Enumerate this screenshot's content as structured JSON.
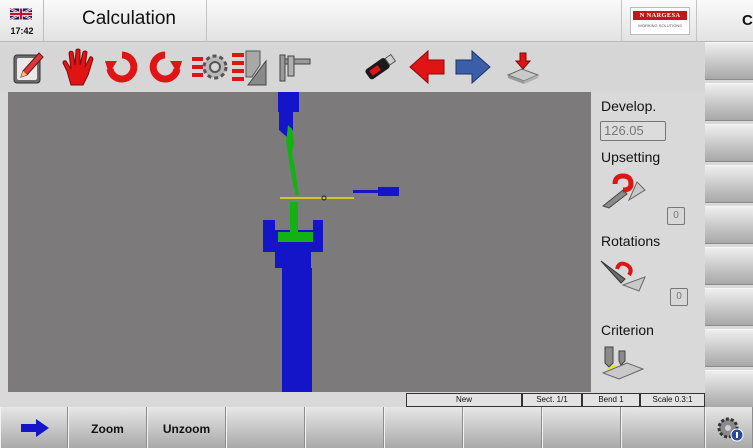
{
  "header": {
    "clock": "17:42",
    "title": "Calculation",
    "logo_text": "N NARGESA",
    "logo_subtext": "WORKING SOLUTIONS",
    "status_letter": "C"
  },
  "toolbar": {
    "icons": [
      "edit-icon",
      "manual-hand-icon",
      "rotate-left-icon",
      "rotate-right-icon",
      "tooling-gear-icon",
      "bend-sequence-icon",
      "caliper-icon",
      "usb-drive-icon",
      "arrow-left-icon",
      "arrow-right-icon",
      "install-icon"
    ]
  },
  "panel": {
    "develop_label": "Develop.",
    "develop_value": "126.05",
    "upsetting_label": "Upsetting",
    "upsetting_value": "0",
    "rotations_label": "Rotations",
    "rotations_value": "0",
    "criterion_label": "Criterion"
  },
  "status_bar": {
    "mode": "New",
    "section": "Sect. 1/1",
    "bend": "Bend 1",
    "scale": "Scale 0.3:1"
  },
  "softkeys": {
    "zoom": "Zoom",
    "unzoom": "Unzoom"
  },
  "colors": {
    "tool_blue": "#1414c8",
    "part_green": "#13b213",
    "canvas_bg": "#7d7a7b",
    "arrow_red": "#e01414",
    "arrow_blue": "#3a5fa8"
  }
}
